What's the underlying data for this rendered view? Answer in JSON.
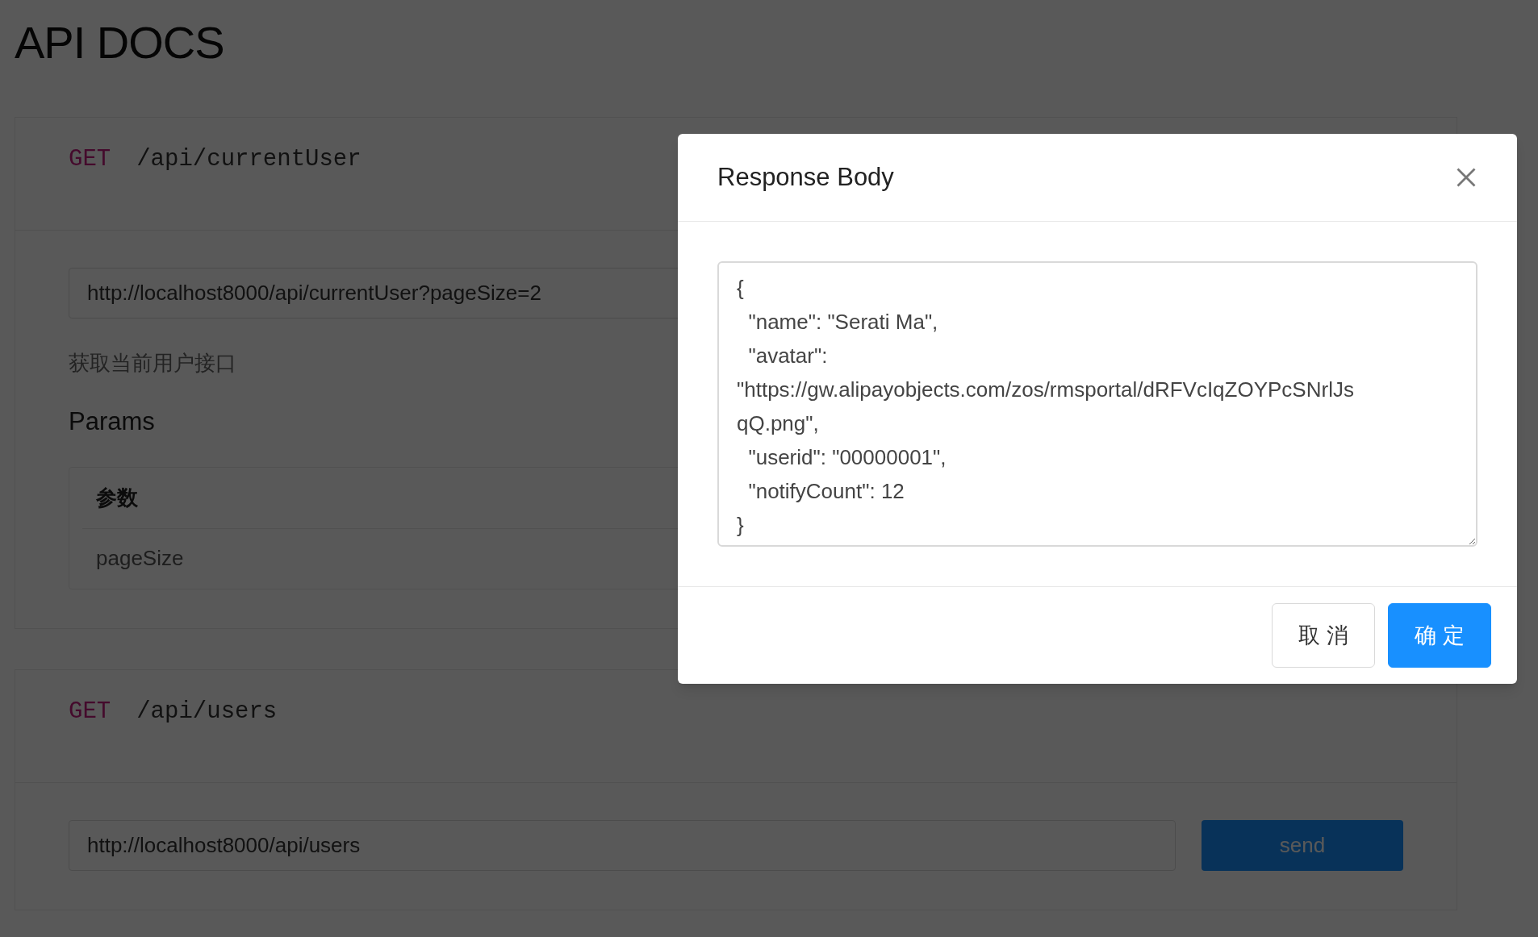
{
  "page": {
    "title": "API DOCS"
  },
  "endpoints": [
    {
      "method": "GET",
      "path": "/api/currentUser",
      "url": "http://localhost8000/api/currentUser?pageSize=2",
      "description": "获取当前用户接口",
      "params_heading": "Params",
      "params_table": {
        "columns": [
          "参数"
        ],
        "rows": [
          [
            "pageSize"
          ]
        ]
      }
    },
    {
      "method": "GET",
      "path": "/api/users",
      "url": "http://localhost8000/api/users",
      "send_button": "send"
    }
  ],
  "modal": {
    "title": "Response Body",
    "body_lines": [
      "{",
      "  \"name\": \"Serati Ma\",",
      "  \"avatar\":",
      "\"https://gw.alipayobjects.com/zos/rmsportal/dRFVcIqZOYPcSNrlJs",
      "qQ.png\",",
      "  \"userid\": \"00000001\",",
      "  \"notifyCount\": 12",
      "}"
    ],
    "buttons": [
      {
        "label": "取 消",
        "kind": "default"
      },
      {
        "label": "确 定",
        "kind": "primary"
      }
    ]
  }
}
